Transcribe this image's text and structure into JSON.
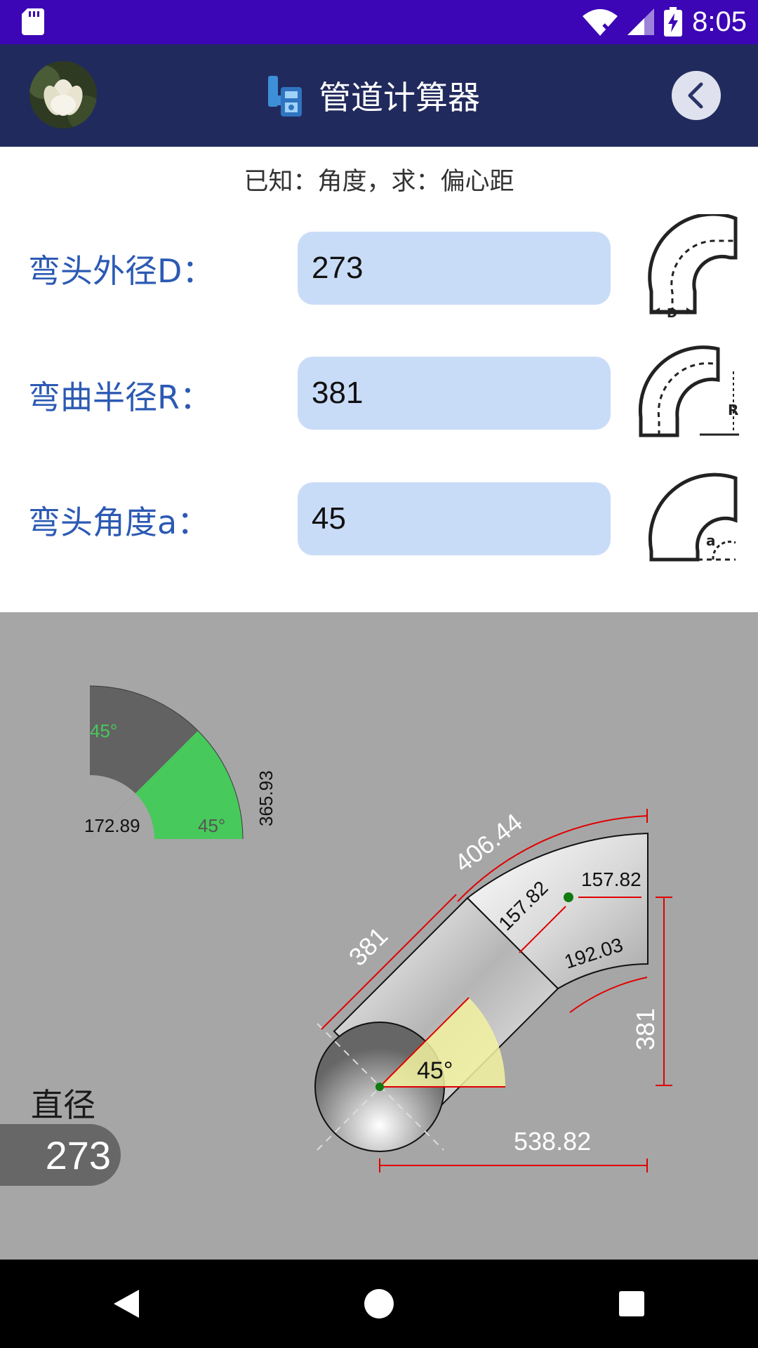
{
  "status_bar": {
    "time": "8:05",
    "icons": [
      "sd-card-icon",
      "wifi-off-icon",
      "signal-icon",
      "battery-charging-icon"
    ]
  },
  "app_bar": {
    "title": "管道计算器",
    "avatar_icon": "flower-avatar",
    "app_icon": "pipe-calculator-icon",
    "back_icon": "chevron-left-icon"
  },
  "subtitle": "已知：角度，求：偏心距",
  "inputs": [
    {
      "label": "弯头外径D：",
      "value": "273",
      "thumb_icon": "elbow-diameter-icon",
      "thumb_letter": "D"
    },
    {
      "label": "弯曲半径R：",
      "value": "381",
      "thumb_icon": "elbow-radius-icon",
      "thumb_letter": "R"
    },
    {
      "label": "弯头角度a：",
      "value": "45",
      "thumb_icon": "elbow-angle-icon",
      "thumb_letter": "a"
    }
  ],
  "diagram": {
    "small": {
      "angle_top": "45°",
      "angle_bottom": "45°",
      "inner": "172.89",
      "height": "365.93"
    },
    "main": {
      "arc_outer": "406.44",
      "straight": "381",
      "mid_diag": "157.82",
      "right_top": "157.82",
      "inner_arc": "192.03",
      "vertical": "381",
      "angle": "45°",
      "horizontal": "538.82"
    },
    "diameter_label": "直径",
    "diameter_value": "273"
  },
  "nav_bar": {
    "icons": [
      "back-triangle-icon",
      "home-circle-icon",
      "recents-square-icon"
    ]
  },
  "colors": {
    "status_bar": "#3c06b6",
    "app_bar": "#212a5c",
    "label_blue": "#2c5ab3",
    "field_bg": "#c9dcf7",
    "diagram_bg": "#a6a6a6",
    "green": "#47c95b",
    "dim_red": "#e00000"
  }
}
